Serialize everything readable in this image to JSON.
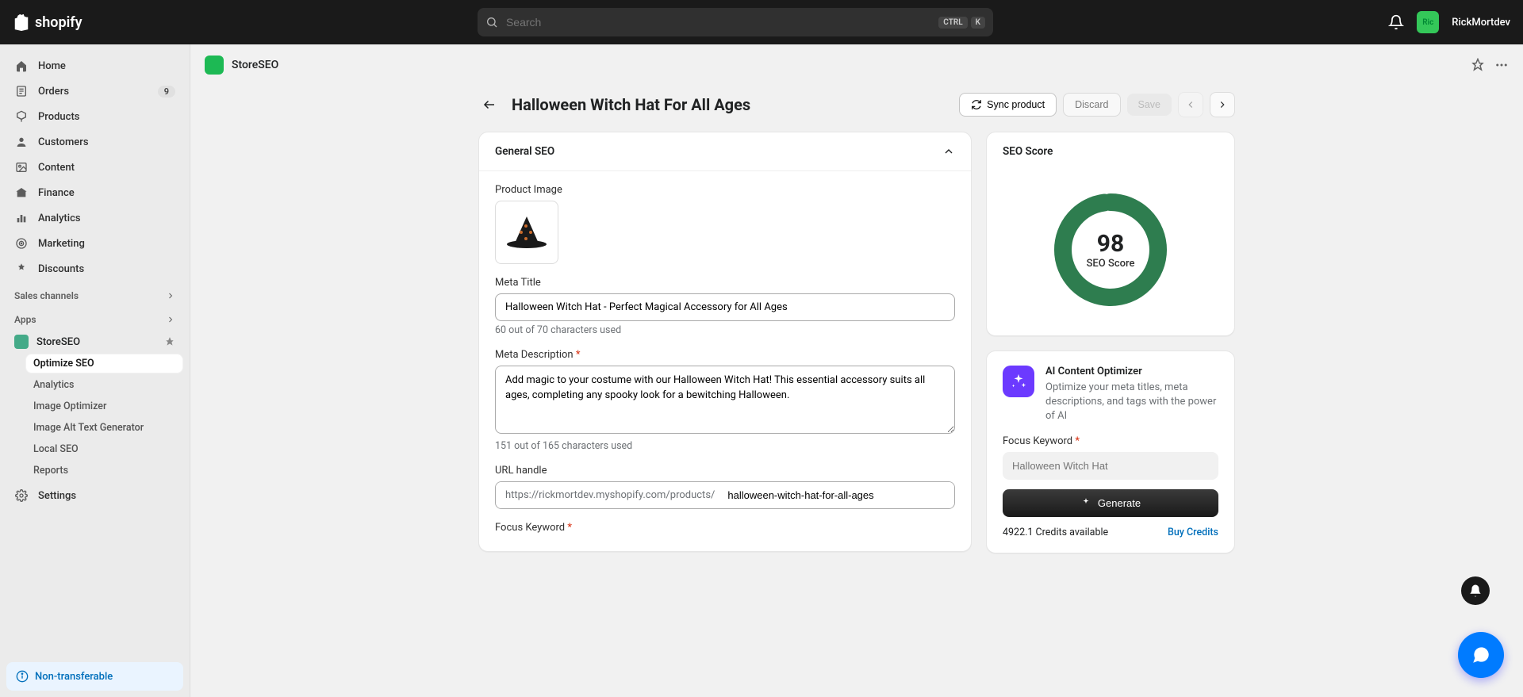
{
  "brand": "shopify",
  "search": {
    "placeholder": "Search",
    "kbd1": "CTRL",
    "kbd2": "K"
  },
  "user": {
    "avatar": "Ric",
    "name": "RickMortdev"
  },
  "sidebar": {
    "main": [
      {
        "label": "Home"
      },
      {
        "label": "Orders",
        "badge": "9"
      },
      {
        "label": "Products"
      },
      {
        "label": "Customers"
      },
      {
        "label": "Content"
      },
      {
        "label": "Finance"
      },
      {
        "label": "Analytics"
      },
      {
        "label": "Marketing"
      },
      {
        "label": "Discounts"
      }
    ],
    "sections": {
      "sales": "Sales channels",
      "apps": "Apps"
    },
    "app": {
      "name": "StoreSEO"
    },
    "sub": [
      {
        "label": "Optimize SEO",
        "selected": true
      },
      {
        "label": "Analytics"
      },
      {
        "label": "Image Optimizer"
      },
      {
        "label": "Image Alt Text Generator"
      },
      {
        "label": "Local SEO"
      },
      {
        "label": "Reports"
      }
    ],
    "settings": "Settings",
    "nonTransfer": "Non-transferable"
  },
  "appHeader": {
    "name": "StoreSEO"
  },
  "page": {
    "title": "Halloween Witch Hat For All Ages",
    "actions": {
      "sync": "Sync product",
      "discard": "Discard",
      "save": "Save"
    }
  },
  "generalSeo": {
    "heading": "General SEO",
    "productImageLabel": "Product Image",
    "metaTitleLabel": "Meta Title",
    "metaTitleValue": "Halloween Witch Hat - Perfect Magical Accessory for All Ages",
    "metaTitleHelp": "60 out of 70 characters used",
    "metaDescLabel": "Meta Description",
    "metaDescValue": "Add magic to your costume with our Halloween Witch Hat! This essential accessory suits all ages, completing any spooky look for a bewitching Halloween.",
    "metaDescHelp": "151 out of 165 characters used",
    "urlLabel": "URL handle",
    "urlPrefix": "https://rickmortdev.myshopify.com/products/",
    "urlValue": "halloween-witch-hat-for-all-ages",
    "focusKeywordLabel": "Focus Keyword"
  },
  "seoScore": {
    "heading": "SEO Score",
    "score": "98",
    "label": "SEO Score"
  },
  "aiOptimizer": {
    "title": "AI Content Optimizer",
    "desc": "Optimize your meta titles, meta descriptions, and tags with the power of AI",
    "focusLabel": "Focus Keyword",
    "focusPlaceholder": "Halloween Witch Hat",
    "generateBtn": "Generate",
    "credits": "4922.1 Credits available",
    "buyLink": "Buy Credits"
  }
}
